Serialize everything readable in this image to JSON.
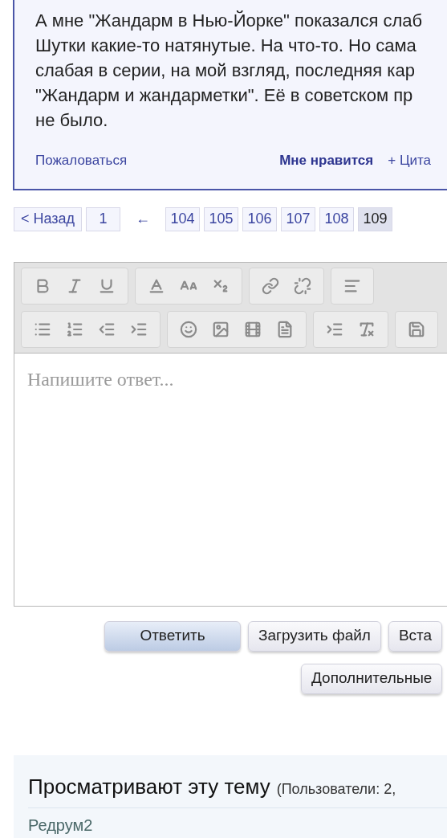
{
  "post": {
    "lines": [
      "А мне \"Жандарм в Нью-Йорке\" показался слаб",
      "Шутки какие-то натянутые. На что-то. Но сама",
      "слабая в серии, на мой взгляд, последняя кар",
      "\"Жандарм и жандарметки\". Её в советском пр",
      "не было."
    ],
    "report": "Пожаловаться",
    "like": "Мне нравится",
    "quote": "+ Цита"
  },
  "pagination": {
    "prev": "< Назад",
    "first": "1",
    "gap": "←",
    "pages": [
      {
        "label": "104",
        "selected": false
      },
      {
        "label": "105",
        "selected": false
      },
      {
        "label": "106",
        "selected": false
      },
      {
        "label": "107",
        "selected": false
      },
      {
        "label": "108",
        "selected": false
      },
      {
        "label": "109",
        "selected": true
      }
    ]
  },
  "editor": {
    "placeholder": "Напишите ответ..."
  },
  "buttons": [
    {
      "label": "Ответить",
      "kind": "primary"
    },
    {
      "label": "Загрузить файл",
      "kind": "secondary"
    },
    {
      "label": "Вста",
      "kind": "secondary"
    }
  ],
  "more_button": "Дополнительные",
  "viewers": {
    "title": "Просматривают эту тему",
    "summary": "(Пользователи: 2,",
    "users": [
      "Редрум2"
    ]
  }
}
